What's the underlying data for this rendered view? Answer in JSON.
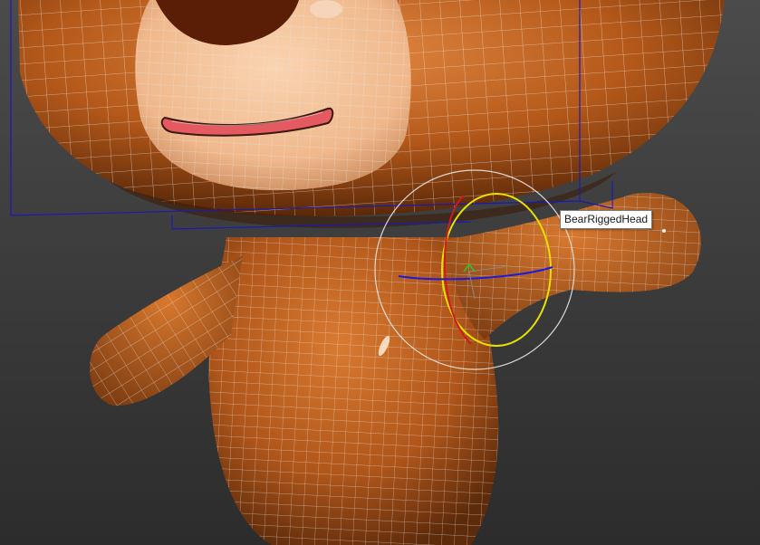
{
  "viewport": {
    "background_top": "#4a4a4a",
    "background_bottom": "#2e2e2e"
  },
  "model": {
    "body_color": "#b85e1c",
    "body_highlight": "#e0873e",
    "body_shadow": "#5a2a08",
    "muzzle_color": "#f2c29a",
    "mouth_color": "#e0555e",
    "wire_color": "#dcdcdc",
    "bbox_color": "#1a1ab4"
  },
  "gizmo": {
    "x_axis_color": "#d01a1a",
    "y_axis_color": "#e8e000",
    "z_axis_color": "#1a1ae0",
    "outer_ring_color": "#e8e8e8"
  },
  "tooltip": {
    "label": "BearRiggedHead"
  }
}
